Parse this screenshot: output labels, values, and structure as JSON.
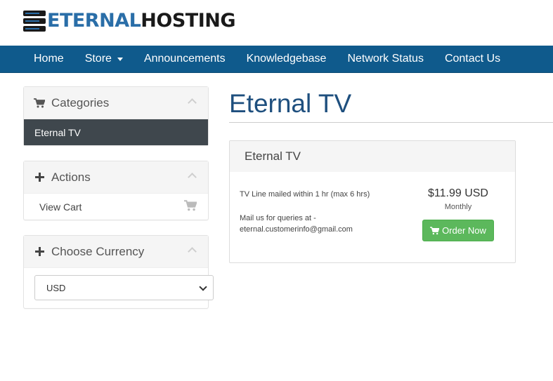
{
  "brand": {
    "logo_part1": "ETERNAL",
    "logo_part2": "HOSTING",
    "logo_icon": "server-stack-icon"
  },
  "nav": {
    "items": [
      {
        "label": "Home"
      },
      {
        "label": "Store",
        "dropdown": true
      },
      {
        "label": "Announcements"
      },
      {
        "label": "Knowledgebase"
      },
      {
        "label": "Network Status"
      },
      {
        "label": "Contact Us"
      }
    ]
  },
  "sidebar": {
    "categories": {
      "title": "Categories",
      "icon": "shopping-cart-icon",
      "items": [
        {
          "label": "Eternal TV",
          "active": true
        }
      ]
    },
    "actions": {
      "title": "Actions",
      "icon": "plus-icon",
      "items": [
        {
          "label": "View Cart",
          "icon": "shopping-cart-icon"
        }
      ]
    },
    "currency": {
      "title": "Choose Currency",
      "icon": "plus-icon",
      "selected": "USD"
    }
  },
  "main": {
    "title": "Eternal TV",
    "product": {
      "name": "Eternal TV",
      "description_line1": "TV Line mailed within 1 hr (max 6 hrs)",
      "description_line2": "Mail us for queries at -",
      "description_line3": "eternal.customerinfo@gmail.com",
      "price": "$11.99 USD",
      "cycle": "Monthly",
      "order_label": "Order Now",
      "order_icon": "shopping-cart-icon"
    }
  },
  "colors": {
    "navbar": "#0f5a8c",
    "title": "#1e4f7e",
    "active_category": "#3f474d",
    "order_button": "#5cb85c"
  }
}
